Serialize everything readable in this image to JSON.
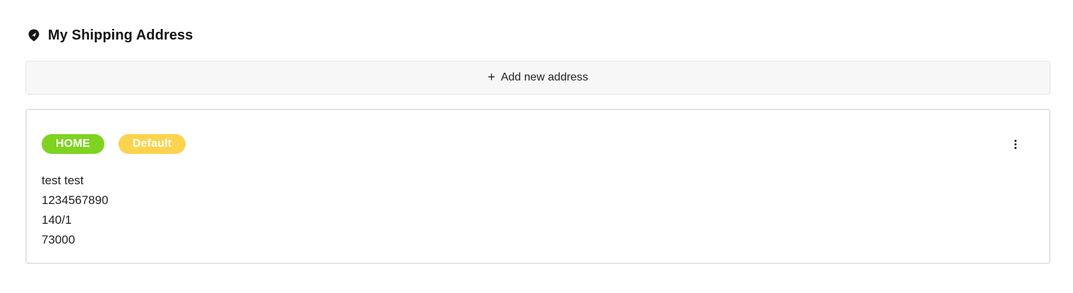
{
  "section": {
    "title": "My Shipping Address",
    "icon": "location-pin-icon"
  },
  "add_address": {
    "icon": "plus-icon",
    "label": "Add new address"
  },
  "address_card": {
    "badges": {
      "type_label": "HOME",
      "type_color": "#7ed321",
      "default_label": "Default",
      "default_color": "#fcd34d"
    },
    "menu_icon": "more-vertical-icon",
    "lines": {
      "name": "test test",
      "phone": "1234567890",
      "street": "140/1",
      "postal_code": "73000"
    }
  }
}
